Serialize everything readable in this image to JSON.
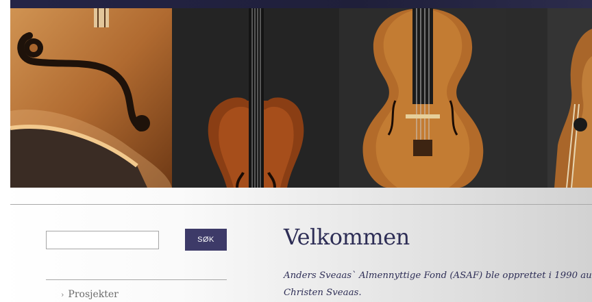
{
  "search": {
    "value": "",
    "placeholder": "",
    "button_label": "SØK"
  },
  "sidebar": {
    "items": [
      {
        "label": "Prosjekter"
      }
    ]
  },
  "main": {
    "title": "Velkommen",
    "intro": "Anders Sveaas` Almennyttige Fond (ASAF) ble opprettet i 1990 au\nChristen Sveaas."
  },
  "colors": {
    "brand_navy": "#3d3a68",
    "heading_text": "#2e2e56",
    "top_bar": "#242446"
  }
}
